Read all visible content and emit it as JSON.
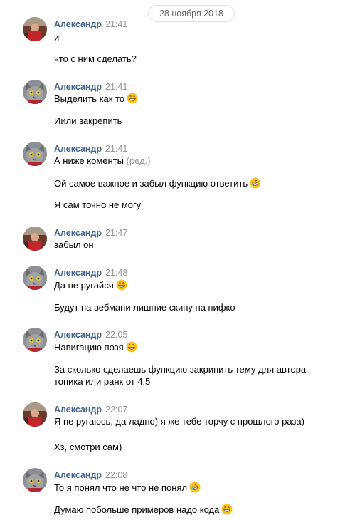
{
  "date_separator": "28 ноября 2018",
  "groups": [
    {
      "author": "Александр",
      "time": "21:41",
      "avatar": "red-photo",
      "messages": [
        {
          "text": "и"
        },
        {
          "text": "что с ним сделать?"
        }
      ]
    },
    {
      "author": "Александр",
      "time": "21:41",
      "avatar": "cat",
      "messages": [
        {
          "text": "Выделить как то",
          "emoji": "grin"
        },
        {
          "text": "Иили закрепить"
        }
      ]
    },
    {
      "author": "Александр",
      "time": "21:41",
      "avatar": "cat",
      "messages": [
        {
          "text": "А ниже коменты",
          "edited": "(ред.)"
        },
        {
          "text": "Ой самое важное и забыл функцию ответить",
          "emoji": "rofl"
        },
        {
          "text": "Я сам точно не могу"
        }
      ]
    },
    {
      "author": "Александр",
      "time": "21:47",
      "avatar": "red-photo",
      "messages": [
        {
          "text": "забыл он"
        }
      ]
    },
    {
      "author": "Александр",
      "time": "21:48",
      "avatar": "cat",
      "messages": [
        {
          "text": "Да не ругайся",
          "emoji": "grin"
        },
        {
          "text": "Будут на вебмани лишние скину на пифко"
        }
      ]
    },
    {
      "author": "Александр",
      "time": "22:05",
      "avatar": "cat",
      "messages": [
        {
          "text": "Навигацию позя",
          "emoji": "grin"
        },
        {
          "text": "За сколько сделаешь функцию закрипить тему для автора"
        },
        {
          "text": "топика или ранк от 4,5"
        }
      ]
    },
    {
      "author": "Александр",
      "time": "22:07",
      "avatar": "red-photo",
      "messages": [
        {
          "text": "Я не ругаюсь, да ладно) я же тебе торчу с прошлого раза)"
        },
        {
          "text": "Хз, смотри сам)"
        }
      ]
    },
    {
      "author": "Александр",
      "time": "22:08",
      "avatar": "cat",
      "messages": [
        {
          "text": "То я понял что не что не понял",
          "emoji": "rofl"
        },
        {
          "text": "Думаю побольше примеров надо кода",
          "emoji": "grin"
        }
      ]
    }
  ]
}
